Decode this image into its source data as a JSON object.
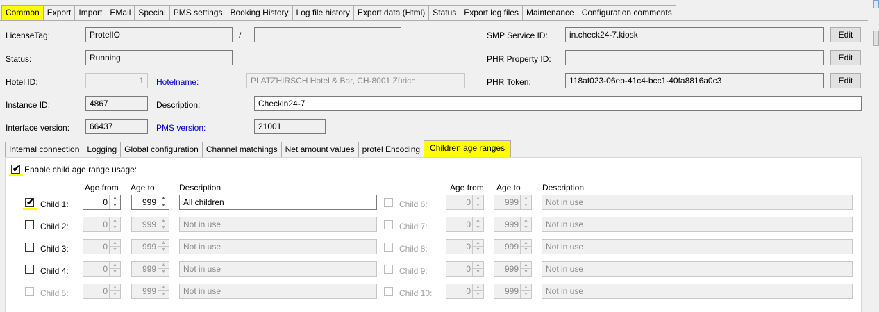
{
  "main_tabs": [
    "Common",
    "Export",
    "Import",
    "EMail",
    "Special",
    "PMS settings",
    "Booking History",
    "Log file history",
    "Export data (Html)",
    "Status",
    "Export log files",
    "Maintenance",
    "Configuration comments"
  ],
  "common": {
    "license_tag_label": "LicenseTag:",
    "license_tag_value": "ProtelIO",
    "separator": "/",
    "license_tag_value2": "",
    "status_label": "Status:",
    "status_value": "Running",
    "hotel_id_label": "Hotel ID:",
    "hotel_id_value": "1",
    "hotelname_label": "Hotelname:",
    "hotelname_value": "PLATZHIRSCH Hotel & Bar, CH-8001 Zürich",
    "instance_id_label": "Instance ID:",
    "instance_id_value": "4867",
    "description_label": "Description:",
    "description_value": "Checkin24-7",
    "interface_version_label": "Interface version:",
    "interface_version_value": "66437",
    "pms_version_label": "PMS version:",
    "pms_version_value": "21001",
    "smp_service_id_label": "SMP Service ID:",
    "smp_service_id_value": "in.check24-7.kiosk",
    "phr_property_id_label": "PHR Property ID:",
    "phr_property_id_value": "",
    "phr_token_label": "PHR Token:",
    "phr_token_value": "118af023-06eb-41c4-bcc1-40fa8816a0c3",
    "edit_label": "Edit"
  },
  "sub_tabs": [
    "Internal connection",
    "Logging",
    "Global configuration",
    "Channel matchings",
    "Net amount values",
    "protel Encoding",
    "Children age ranges"
  ],
  "children": {
    "enable_label": "Enable child age range usage:",
    "enable_checked": true,
    "header_age_from": "Age from",
    "header_age_to": "Age to",
    "header_description": "Description",
    "left": [
      {
        "label": "Child 1:",
        "checked": true,
        "enabled": true,
        "from": "0",
        "to": "999",
        "desc": "All children"
      },
      {
        "label": "Child 2:",
        "checked": false,
        "enabled": true,
        "from": "0",
        "to": "999",
        "desc": "Not in use"
      },
      {
        "label": "Child 3:",
        "checked": false,
        "enabled": true,
        "from": "0",
        "to": "999",
        "desc": "Not in use"
      },
      {
        "label": "Child 4:",
        "checked": false,
        "enabled": true,
        "from": "0",
        "to": "999",
        "desc": "Not in use"
      },
      {
        "label": "Child 5:",
        "checked": false,
        "enabled": false,
        "from": "0",
        "to": "999",
        "desc": "Not in use"
      }
    ],
    "right": [
      {
        "label": "Child 6:",
        "checked": false,
        "enabled": false,
        "from": "0",
        "to": "999",
        "desc": "Not in use"
      },
      {
        "label": "Child 7:",
        "checked": false,
        "enabled": false,
        "from": "0",
        "to": "999",
        "desc": "Not in use"
      },
      {
        "label": "Child 8:",
        "checked": false,
        "enabled": false,
        "from": "0",
        "to": "999",
        "desc": "Not in use"
      },
      {
        "label": "Child 9:",
        "checked": false,
        "enabled": false,
        "from": "0",
        "to": "999",
        "desc": "Not in use"
      },
      {
        "label": "Child 10:",
        "checked": false,
        "enabled": false,
        "from": "0",
        "to": "999",
        "desc": "Not in use"
      }
    ]
  }
}
